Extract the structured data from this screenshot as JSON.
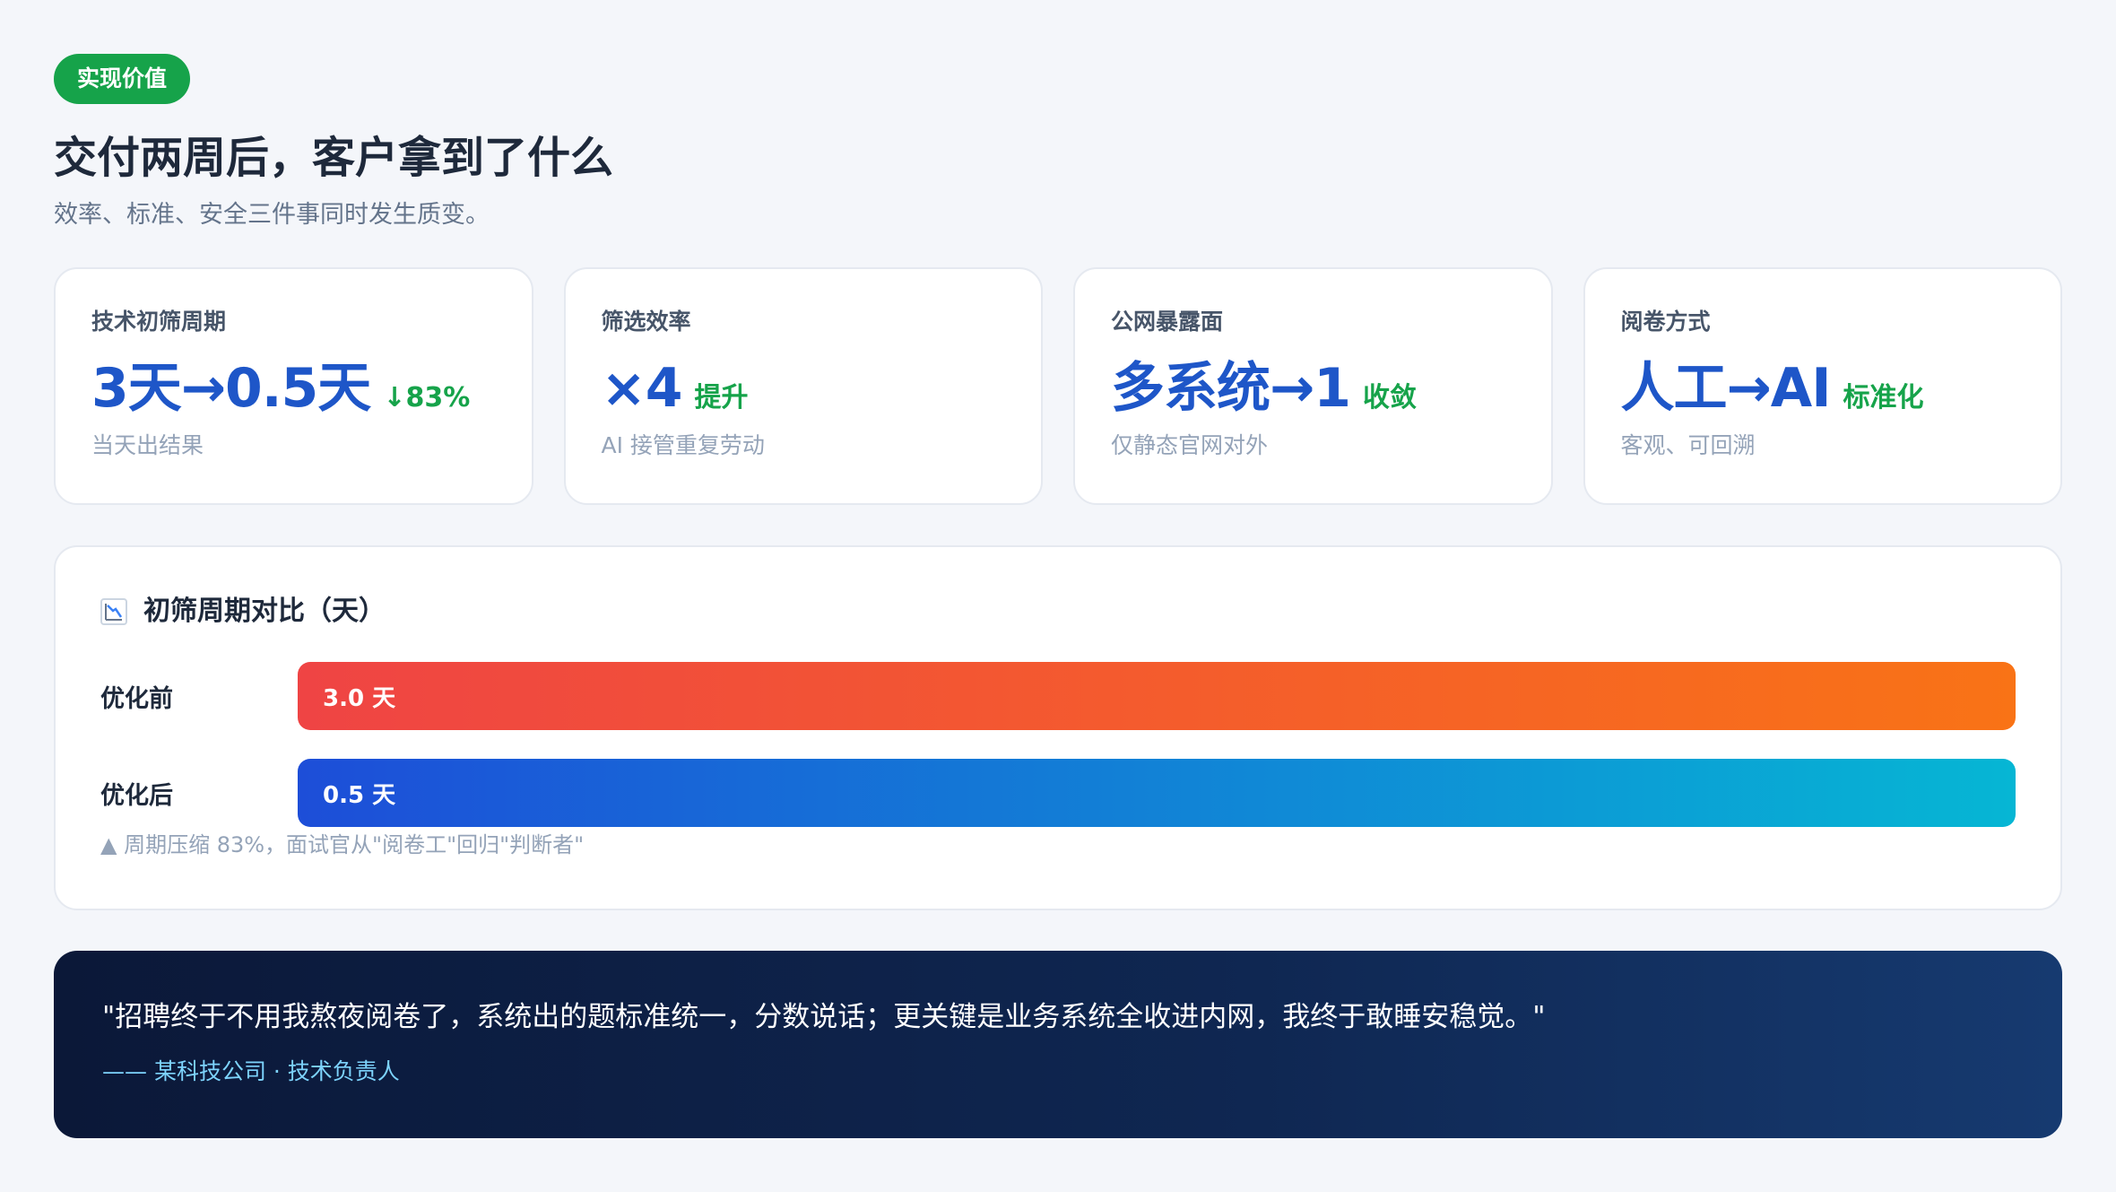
{
  "tag": "实现价值",
  "title": "交付两周后，客户拿到了什么",
  "subtitle": "效率、标准、安全三件事同时发生质变。",
  "colors": {
    "brand_blue": "#1e56c8",
    "positive_green": "#16a34a",
    "before_bar": [
      "#ef4444",
      "#f97316"
    ],
    "after_bar": [
      "#1d4ed8",
      "#06b6d4"
    ],
    "quote_bg": "#0b1838"
  },
  "cards": [
    {
      "label": "技术初筛周期",
      "value": "3天→0.5天",
      "badge": "↓83%",
      "note": "当天出结果"
    },
    {
      "label": "筛选效率",
      "value": "×4",
      "badge": "提升",
      "note": "AI 接管重复劳动"
    },
    {
      "label": "公网暴露面",
      "value": "多系统→1",
      "badge": "收敛",
      "note": "仅静态官网对外"
    },
    {
      "label": "阅卷方式",
      "value": "人工→AI",
      "badge": "标准化",
      "note": "客观、可回溯"
    }
  ],
  "chart_data": {
    "type": "bar",
    "orientation": "horizontal",
    "title": "初筛周期对比（天）",
    "icon": "chart-down-icon",
    "categories": [
      "优化前",
      "优化后"
    ],
    "values": [
      3.0,
      0.5
    ],
    "value_labels": [
      "3.0 天",
      "0.5 天"
    ],
    "note": "▲ 周期压缩 83%，面试官从\"阅卷工\"回归\"判断者\"",
    "grid": false
  },
  "quote": {
    "text": "\"招聘终于不用我熬夜阅卷了，系统出的题标准统一，分数说话；更关键是业务系统全收进内网，我终于敢睡安稳觉。\"",
    "author": "—— 某科技公司 · 技术负责人"
  }
}
